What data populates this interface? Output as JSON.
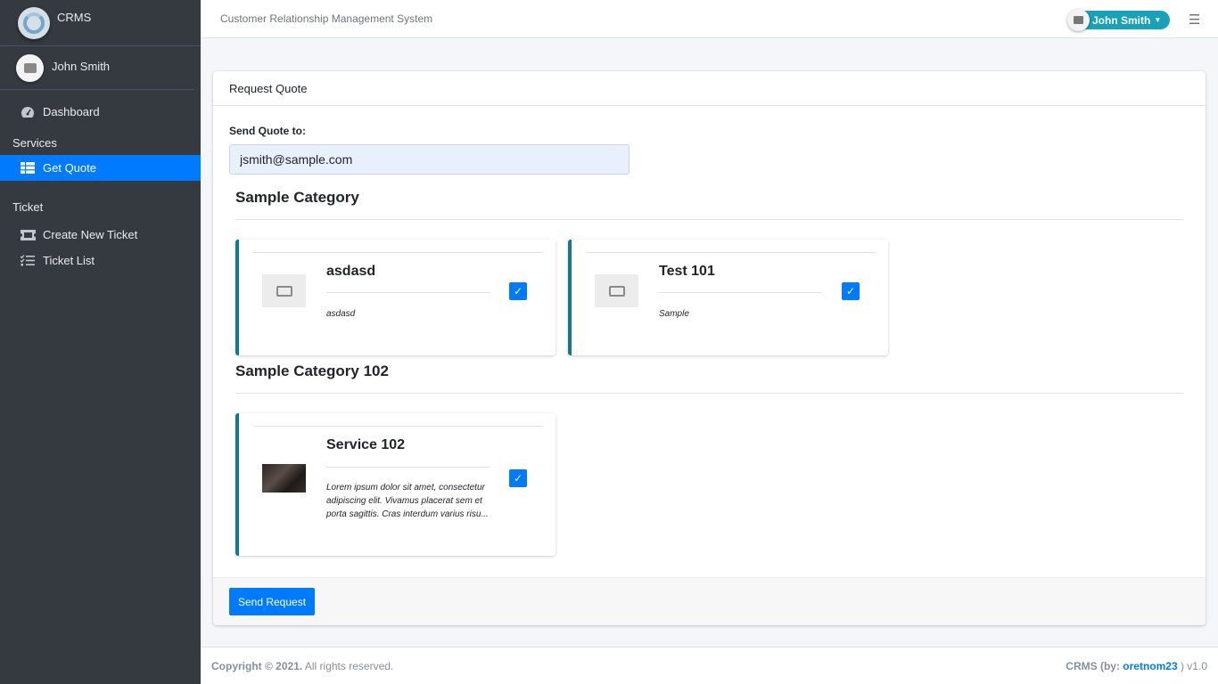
{
  "brand": {
    "name": "CRMS"
  },
  "sidebar": {
    "user_name": "John Smith",
    "items": [
      {
        "label": "Dashboard",
        "icon": "gauge-icon"
      }
    ],
    "sections": [
      {
        "header": "Services",
        "items": [
          {
            "label": "Get Quote",
            "icon": "table-icon",
            "active": true
          }
        ]
      },
      {
        "header": "Ticket",
        "items": [
          {
            "label": "Create New Ticket",
            "icon": "ticket-icon"
          },
          {
            "label": "Ticket List",
            "icon": "tasks-icon"
          }
        ]
      }
    ]
  },
  "navbar": {
    "title": "Customer Relationship Management System",
    "user_name": "John Smith",
    "accent": "#17a2b8"
  },
  "card": {
    "header": "Request Quote",
    "send_to_label": "Send Quote to:",
    "email_value": "jsmith@sample.com",
    "send_button": "Send Request"
  },
  "categories": [
    {
      "title": "Sample Category",
      "services": [
        {
          "name": "asdasd",
          "description": "asdasd",
          "checked": true,
          "image": "no-image"
        },
        {
          "name": "Test 101",
          "description": "Sample",
          "checked": true,
          "image": "no-image"
        }
      ]
    },
    {
      "title": "Sample Category 102",
      "services": [
        {
          "name": "Service 102",
          "description": "Lorem ipsum dolor sit amet, consectetur adipiscing elit. Vivamus placerat sem et porta sagittis. Cras interdum varius risu...",
          "checked": true,
          "image": "photo"
        }
      ]
    }
  ],
  "footer": {
    "copyright": "Copyright © 2021.",
    "rights": " All rights reserved.",
    "credit_prefix": "CRMS (by: ",
    "credit_link": "oretnom23",
    "credit_suffix": " ) v1.0"
  },
  "colors": {
    "primary": "#007bff",
    "sidebar_bg": "#343a40",
    "card_accent": "#117a8b"
  }
}
